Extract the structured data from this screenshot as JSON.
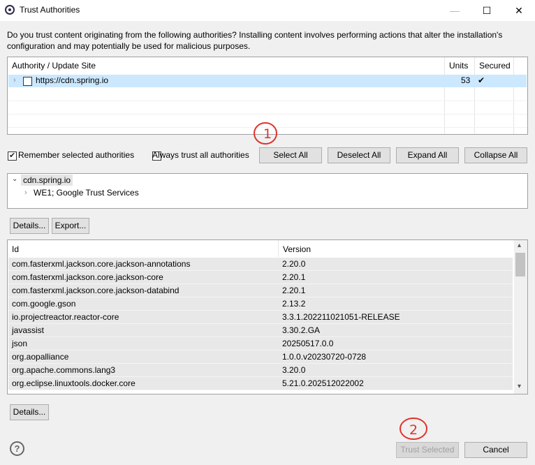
{
  "window": {
    "title": "Trust Authorities",
    "minimize_icon": "—",
    "maximize_icon": "☐",
    "close_icon": "✕"
  },
  "description": "Do you trust content originating from the following authorities?  Installing content involves performing actions that alter the installation's configuration and may potentially be used for malicious purposes.",
  "authorities_table": {
    "headers": {
      "site": "Authority / Update Site",
      "units": "Units",
      "secured": "Secured"
    },
    "rows": [
      {
        "site": "https://cdn.spring.io",
        "units": "53",
        "secured": "✔"
      }
    ]
  },
  "options": {
    "remember_label": "Remember selected authorities",
    "always_trust_label": "Always trust all authorities",
    "remember_checked": true,
    "always_trust_checked": false
  },
  "buttons": {
    "select_all": "Select All",
    "deselect_all": "Deselect All",
    "expand_all": "Expand All",
    "collapse_all": "Collapse All",
    "details": "Details...",
    "export": "Export...",
    "details_bottom": "Details...",
    "trust_selected": "Trust Selected",
    "cancel": "Cancel"
  },
  "cert_tree": {
    "root": "cdn.spring.io",
    "child": "WE1; Google Trust Services"
  },
  "units_table": {
    "headers": {
      "id": "Id",
      "version": "Version"
    },
    "rows": [
      {
        "id": "com.fasterxml.jackson.core.jackson-annotations",
        "version": "2.20.0"
      },
      {
        "id": "com.fasterxml.jackson.core.jackson-core",
        "version": "2.20.1"
      },
      {
        "id": "com.fasterxml.jackson.core.jackson-databind",
        "version": "2.20.1"
      },
      {
        "id": "com.google.gson",
        "version": "2.13.2"
      },
      {
        "id": "io.projectreactor.reactor-core",
        "version": "3.3.1.202211021051-RELEASE"
      },
      {
        "id": "javassist",
        "version": "3.30.2.GA"
      },
      {
        "id": "json",
        "version": "20250517.0.0"
      },
      {
        "id": "org.aopalliance",
        "version": "1.0.0.v20230720-0728"
      },
      {
        "id": "org.apache.commons.lang3",
        "version": "3.20.0"
      },
      {
        "id": "org.eclipse.linuxtools.docker.core",
        "version": "5.21.0.202512022002"
      }
    ]
  },
  "annotations": {
    "one": "1",
    "two": "2"
  },
  "colors": {
    "selection": "#cce8ff",
    "annotation": "#e0322b",
    "row_bg": "#e8e8e8"
  }
}
